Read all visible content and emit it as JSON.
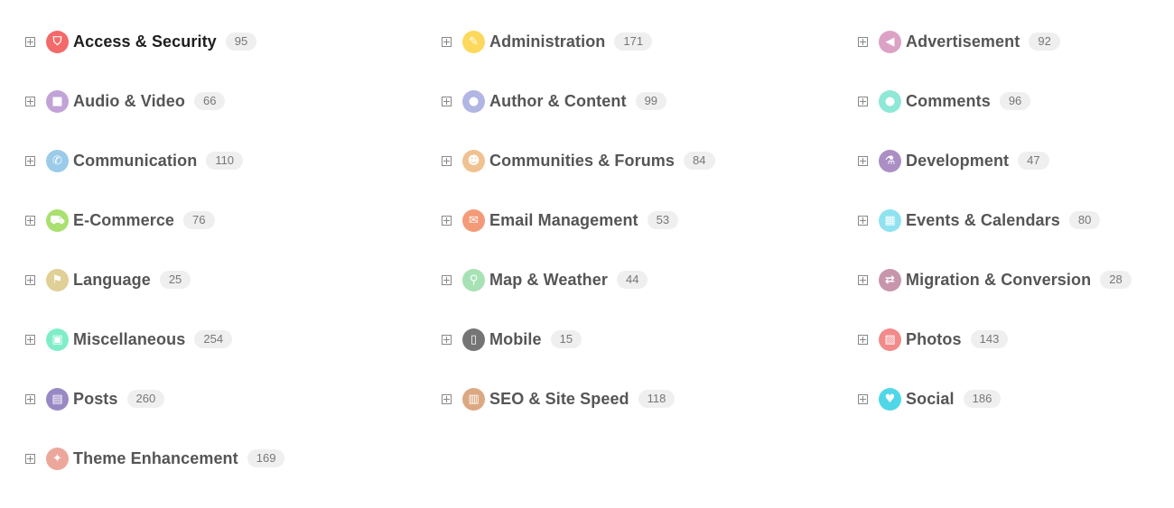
{
  "columns": [
    [
      {
        "label": "Access & Security",
        "count": "95",
        "icon": "shield-icon",
        "glyph": "⛉",
        "color": "#f26a6a",
        "active": true
      },
      {
        "label": "Audio & Video",
        "count": "66",
        "icon": "video-camera-icon",
        "glyph": "■",
        "color": "#c1a3d8"
      },
      {
        "label": "Communication",
        "count": "110",
        "icon": "phone-icon",
        "glyph": "✆",
        "color": "#9acbe8"
      },
      {
        "label": "E-Commerce",
        "count": "76",
        "icon": "cart-icon",
        "glyph": "⛟",
        "color": "#a9e06f"
      },
      {
        "label": "Language",
        "count": "25",
        "icon": "flag-icon",
        "glyph": "⚑",
        "color": "#e0cf96"
      },
      {
        "label": "Miscellaneous",
        "count": "254",
        "icon": "briefcase-icon",
        "glyph": "▣",
        "color": "#7feec8"
      },
      {
        "label": "Posts",
        "count": "260",
        "icon": "document-icon",
        "glyph": "▤",
        "color": "#9a88c4"
      },
      {
        "label": "Theme Enhancement",
        "count": "169",
        "icon": "magic-wand-icon",
        "glyph": "✦",
        "color": "#eca79c"
      }
    ],
    [
      {
        "label": "Administration",
        "count": "171",
        "icon": "wrench-icon",
        "glyph": "✎",
        "color": "#fcd95c"
      },
      {
        "label": "Author & Content",
        "count": "99",
        "icon": "user-icon",
        "glyph": "●",
        "color": "#b2b6e2"
      },
      {
        "label": "Communities & Forums",
        "count": "84",
        "icon": "group-icon",
        "glyph": "☻",
        "color": "#f0c291"
      },
      {
        "label": "Email Management",
        "count": "53",
        "icon": "envelope-icon",
        "glyph": "✉",
        "color": "#f39a78"
      },
      {
        "label": "Map & Weather",
        "count": "44",
        "icon": "map-pin-icon",
        "glyph": "⚲",
        "color": "#a7e2b4"
      },
      {
        "label": "Mobile",
        "count": "15",
        "icon": "mobile-phone-icon",
        "glyph": "▯",
        "color": "#757575"
      },
      {
        "label": "SEO & Site Speed",
        "count": "118",
        "icon": "bar-chart-icon",
        "glyph": "▥",
        "color": "#dca882"
      }
    ],
    [
      {
        "label": "Advertisement",
        "count": "92",
        "icon": "megaphone-icon",
        "glyph": "◀",
        "color": "#dba2c6"
      },
      {
        "label": "Comments",
        "count": "96",
        "icon": "speech-bubble-icon",
        "glyph": "●",
        "color": "#8ee8d6"
      },
      {
        "label": "Development",
        "count": "47",
        "icon": "flask-icon",
        "glyph": "⚗",
        "color": "#ab8ec4"
      },
      {
        "label": "Events & Calendars",
        "count": "80",
        "icon": "calendar-icon",
        "glyph": "▦",
        "color": "#8fe2f0"
      },
      {
        "label": "Migration & Conversion",
        "count": "28",
        "icon": "arrows-exchange-icon",
        "glyph": "⇄",
        "color": "#c796ac"
      },
      {
        "label": "Photos",
        "count": "143",
        "icon": "image-icon",
        "glyph": "▨",
        "color": "#f28a8a"
      },
      {
        "label": "Social",
        "count": "186",
        "icon": "twitter-bird-icon",
        "glyph": "♥",
        "color": "#4fd7e8"
      }
    ]
  ]
}
